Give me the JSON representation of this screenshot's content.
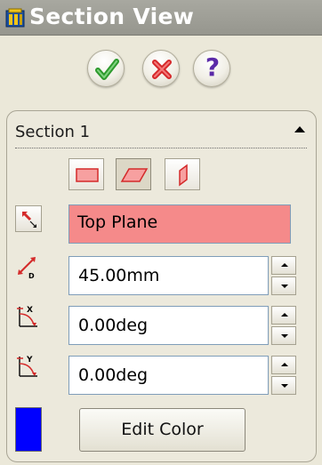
{
  "window": {
    "title": "Section View",
    "title_icon": "section-view-icon"
  },
  "actions": {
    "ok": {
      "icon": "check-icon",
      "color": "#2e9a2e"
    },
    "cancel": {
      "icon": "x-icon",
      "color": "#d6282a"
    },
    "help": {
      "label": "?",
      "icon": "question-icon",
      "color": "#5b2aa8"
    }
  },
  "section": {
    "header": "Section 1",
    "collapse_icon": "collapse-up-arrow-icon",
    "planes": [
      {
        "name": "front-plane",
        "icon": "front-plane-icon",
        "selected": false
      },
      {
        "name": "top-plane",
        "icon": "top-plane-icon",
        "selected": true
      },
      {
        "name": "right-plane",
        "icon": "right-plane-icon",
        "selected": false
      }
    ],
    "reference": {
      "icon": "reverse-direction-icon",
      "value": "Top Plane",
      "highlight_color": "#f58a8a"
    },
    "offset_distance": {
      "icon": "offset-distance-icon",
      "value": "45.00mm"
    },
    "x_rotation": {
      "icon": "x-rotation-icon",
      "value": "0.00deg"
    },
    "y_rotation": {
      "icon": "y-rotation-icon",
      "value": "0.00deg"
    },
    "color": {
      "swatch": "#0000ff",
      "button_label": "Edit Color"
    }
  }
}
